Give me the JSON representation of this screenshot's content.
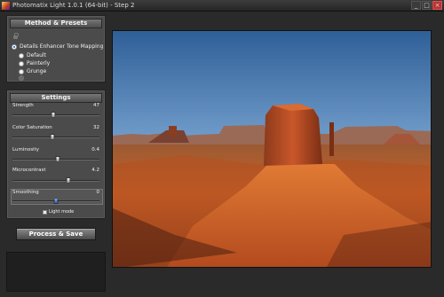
{
  "window": {
    "title": "Photomatix Light 1.0.1 (64-bit) - Step 2",
    "controls": [
      "_",
      "□",
      "×"
    ]
  },
  "method_panel": {
    "header": "Method & Presets",
    "method_option": "Details Enhancer Tone Mapping",
    "presets": [
      "Default",
      "Painterly",
      "Grunge"
    ]
  },
  "settings_panel": {
    "header": "Settings",
    "strength": {
      "label": "Strength",
      "value": "47",
      "fraction": 0.47
    },
    "color_saturation": {
      "label": "Color Saturation",
      "value": "32",
      "fraction": 0.46
    },
    "luminosity": {
      "label": "Luminosity",
      "value": "0.4",
      "fraction": 0.52
    },
    "microcontrast": {
      "label": "Microcontrast",
      "value": "4.2",
      "fraction": 0.64
    },
    "smoothing": {
      "label": "Smoothing",
      "value": "0",
      "fraction": 0.5
    },
    "light_mode_label": "Light mode"
  },
  "process_button": "Process & Save",
  "colors": {
    "panel_bg": "#4b4b4b",
    "window_bg": "#2a2a2a",
    "accent_blue": "#3a7bd5"
  },
  "icons": [
    "app-icon",
    "lock-icon",
    "minimize-icon",
    "maximize-icon",
    "close-icon"
  ]
}
